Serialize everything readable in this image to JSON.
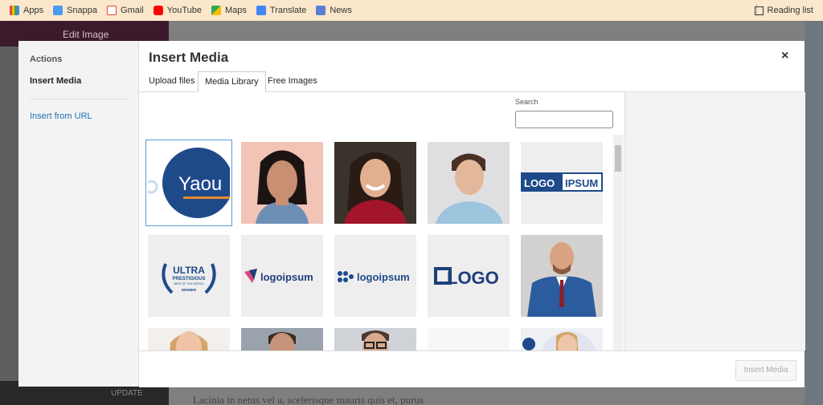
{
  "bookmarks": {
    "items": [
      {
        "label": "Apps",
        "icon": "apps-icon",
        "color": "#4285f4"
      },
      {
        "label": "Snappa",
        "icon": "snappa-icon",
        "color": "#3b82f6"
      },
      {
        "label": "Gmail",
        "icon": "gmail-icon",
        "color": "#ea4335"
      },
      {
        "label": "YouTube",
        "icon": "youtube-icon",
        "color": "#ff0000"
      },
      {
        "label": "Maps",
        "icon": "maps-icon",
        "color": "#34a853"
      },
      {
        "label": "Translate",
        "icon": "translate-icon",
        "color": "#4285f4"
      },
      {
        "label": "News",
        "icon": "news-icon",
        "color": "#5a7fd6"
      }
    ],
    "reading_list": "Reading list"
  },
  "background": {
    "edit_title": "Edit Image",
    "update_label": "UPDATE",
    "body_text": "Lacinia in netus vel a, scelerisque mauris quis et, purus"
  },
  "modal": {
    "title": "Insert Media",
    "close": "×",
    "sidebar": {
      "actions": "Actions",
      "insert_media": "Insert Media",
      "insert_from_url": "Insert from URL"
    },
    "tabs": [
      "Upload files",
      "Media Library",
      "Free Images"
    ],
    "active_tab": "Media Library",
    "search_label": "Search",
    "search_value": "",
    "insert_button": "Insert Media"
  },
  "media": {
    "row1": [
      "Yaou",
      "portrait-woman-dark-hair",
      "portrait-woman-smiling",
      "portrait-man-profile",
      "LOGO IPSUM"
    ],
    "row2": [
      "ULTRA PRESTIGIOUS BEST OF THE WORLD WINNER",
      "logoipsum",
      "logoipsum",
      "LOGO",
      "portrait-man-suit"
    ],
    "yaou_text": "Yaou",
    "logo_ipsum_1": "LOGO",
    "logo_ipsum_2": "IPSUM",
    "ultra_1": "ULTRA",
    "ultra_2": "PRESTIGIOUS",
    "ultra_3": "BEST OF THE WORLD",
    "ultra_4": "WINNER",
    "logoipsum_a": "logoipsum",
    "logoipsum_b": "logoipsum",
    "logo_c": "LOGO"
  },
  "colors": {
    "accent": "#2271b1",
    "brand_blue": "#1f4a8a"
  }
}
